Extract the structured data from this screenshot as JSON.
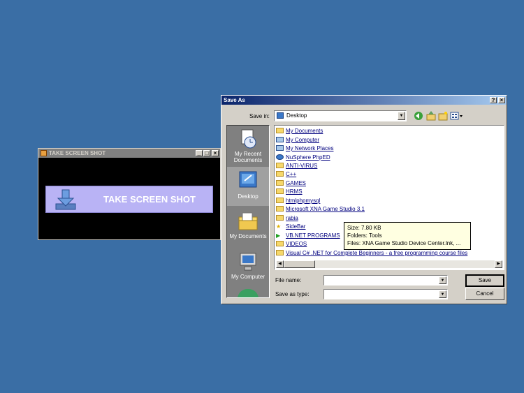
{
  "tss_window": {
    "title": "TAKE SCREEN SHOT",
    "button_label": "TAKE SCREEN SHOT"
  },
  "save_dialog": {
    "title": "Save As",
    "help_glyph": "?",
    "close_glyph": "×",
    "save_in_label": "Save in:",
    "save_in_value": "Desktop",
    "places": [
      "My Recent Documents",
      "Desktop",
      "My Documents",
      "My Computer"
    ],
    "files": [
      "My Documents",
      "My Computer",
      "My Network Places",
      "NuSphere PhpED",
      "ANTI-VIRUS",
      "C++",
      "GAMES",
      "HRMS",
      "htmlphpmysql",
      "Microsoft XNA Game Studio 3.1",
      "rabia",
      "SideBar",
      "VB.NET PROGRAMS",
      "VIDEOS",
      "Visual C# .NET for Complete Beginners - a free programming course files"
    ],
    "tooltip": {
      "line1": "Size: 7.80 KB",
      "line2": "Folders: Tools",
      "line3": "Files: XNA Game Studio Device Center.lnk, ..."
    },
    "file_name_label": "File name:",
    "file_name_value": "",
    "save_as_type_label": "Save as type:",
    "save_as_type_value": "",
    "save_button": "Save",
    "cancel_button": "Cancel"
  }
}
